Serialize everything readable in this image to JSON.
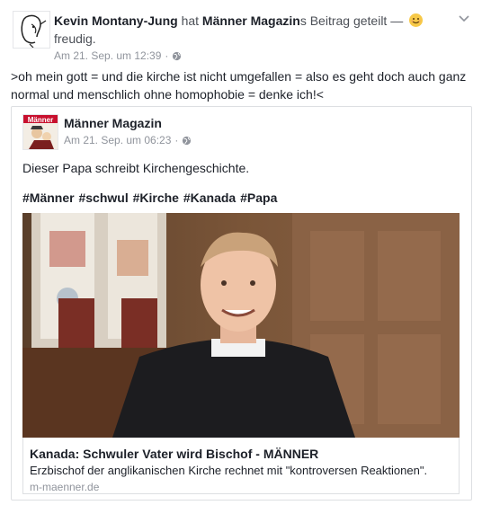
{
  "post": {
    "author": "Kevin Montany-Jung",
    "shared_word": "hat",
    "page_name": "Männer Magazin",
    "shared_suffix": "s Beitrag geteilt —",
    "feeling": "freudig.",
    "timestamp": "Am 21. Sep. um 12:39",
    "body_text": ">oh mein gott  = und die kirche  ist nicht umgefallen = also es geht doch auch ganz normal und menschlich ohne homophobie  = denke ich!<"
  },
  "shared": {
    "page_name": "Männer Magazin",
    "avatar_label": "Männer",
    "timestamp": "Am 21. Sep. um 06:23",
    "text": "Dieser Papa schreibt Kirchengeschichte.",
    "hashtags": [
      "#Männer",
      "#schwul",
      "#Kirche",
      "#Kanada",
      "#Papa"
    ],
    "link": {
      "title": "Kanada: Schwuler Vater wird Bischof - MÄNNER",
      "description": "Erzbischof der anglikanischen Kirche rechnet mit \"kontroversen Reaktionen\".",
      "domain": "m-maenner.de"
    }
  },
  "icons": {
    "globe": "globe-icon",
    "chevron": "chevron-down-icon",
    "emoji": "smiling-face-emoji"
  },
  "colors": {
    "text": "#1d2129",
    "muted": "#90949c",
    "border": "#dddfe2",
    "emoji": "#f7c948"
  }
}
